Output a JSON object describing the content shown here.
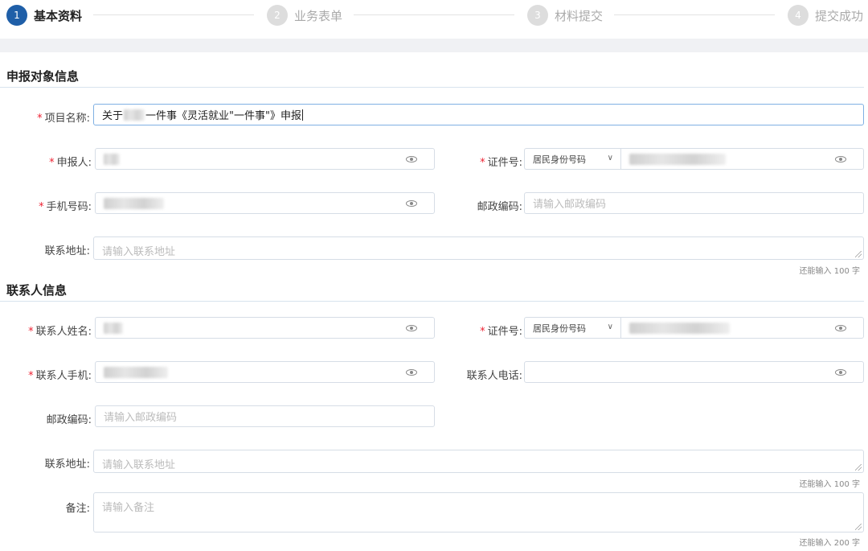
{
  "steps": [
    {
      "num": "1",
      "label": "基本资料",
      "active": true
    },
    {
      "num": "2",
      "label": "业务表单",
      "active": false
    },
    {
      "num": "3",
      "label": "材料提交",
      "active": false
    },
    {
      "num": "4",
      "label": "提交成功",
      "active": false
    }
  ],
  "section1": {
    "title": "申报对象信息"
  },
  "section2": {
    "title": "联系人信息"
  },
  "form": {
    "project_name_label": "项目名称:",
    "project_name_value_prefix": "关于",
    "project_name_value_suffix": "一件事《灵活就业\"一件事\"》申报",
    "applicant_label": "申报人:",
    "id_label": "证件号:",
    "id_type": "居民身份号码",
    "phone_label": "手机号码:",
    "postal_label": "邮政编码:",
    "postal_placeholder": "请输入邮政编码",
    "address_label": "联系地址:",
    "address_placeholder": "请输入联系地址",
    "address_counter": "还能输入 100 字",
    "contact_name_label": "联系人姓名:",
    "contact_id_label": "证件号:",
    "contact_id_type": "居民身份号码",
    "contact_phone_label": "联系人手机:",
    "contact_tel_label": "联系人电话:",
    "contact_postal_label": "邮政编码:",
    "contact_postal_placeholder": "请输入邮政编码",
    "contact_address_label": "联系地址:",
    "contact_address_placeholder": "请输入联系地址",
    "contact_address_counter": "还能输入 100 字",
    "remark_label": "备注:",
    "remark_placeholder": "请输入备注",
    "remark_counter": "还能输入 200 字"
  },
  "icons": {
    "visibility": "eye-icon",
    "dropdown": "chevron-down-icon"
  }
}
